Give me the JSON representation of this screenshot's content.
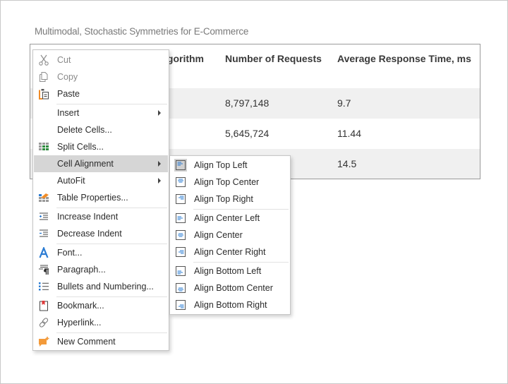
{
  "document": {
    "title": "Multimodal, Stochastic Symmetries for E-Commerce"
  },
  "table": {
    "headers": [
      "Algorithm",
      "Number of Requests",
      "Average Response Time, ms"
    ],
    "header_visible_fragment": "lgorithm",
    "rows": [
      {
        "requests": "8,797,148",
        "response_time": "9.7"
      },
      {
        "requests": "5,645,724",
        "response_time": "11.44"
      },
      {
        "requests": "",
        "response_time": "14.5"
      }
    ]
  },
  "context_menu": {
    "items": [
      {
        "label": "Cut",
        "icon": "scissors-icon",
        "disabled": true
      },
      {
        "label": "Copy",
        "icon": "copy-icon",
        "disabled": true
      },
      {
        "label": "Paste",
        "icon": "clipboard-paste-icon"
      },
      {
        "label": "Insert",
        "submenu": true
      },
      {
        "label": "Delete Cells..."
      },
      {
        "label": "Split Cells...",
        "icon": "split-cells-icon"
      },
      {
        "label": "Cell Alignment",
        "submenu": true,
        "active": true
      },
      {
        "label": "AutoFit",
        "submenu": true
      },
      {
        "label": "Table Properties...",
        "icon": "table-properties-icon"
      },
      {
        "label": "Increase Indent",
        "icon": "increase-indent-icon"
      },
      {
        "label": "Decrease Indent",
        "icon": "decrease-indent-icon"
      },
      {
        "label": "Font...",
        "icon": "font-icon"
      },
      {
        "label": "Paragraph...",
        "icon": "paragraph-icon"
      },
      {
        "label": "Bullets and Numbering...",
        "icon": "bullets-icon"
      },
      {
        "label": "Bookmark...",
        "icon": "bookmark-icon"
      },
      {
        "label": "Hyperlink...",
        "icon": "hyperlink-icon"
      },
      {
        "label": "New Comment",
        "icon": "new-comment-icon"
      }
    ]
  },
  "alignment_submenu": {
    "items": [
      {
        "label": "Align Top Left",
        "selected": true
      },
      {
        "label": "Align Top Center"
      },
      {
        "label": "Align Top Right"
      },
      {
        "label": "Align Center Left"
      },
      {
        "label": "Align Center"
      },
      {
        "label": "Align Center Right"
      },
      {
        "label": "Align Bottom Left"
      },
      {
        "label": "Align Bottom Center"
      },
      {
        "label": "Align Bottom Right"
      }
    ]
  },
  "colors": {
    "accent_blue": "#2b7cd3",
    "paste_orange": "#f08c28",
    "split_green": "#2e8b3e",
    "bookmark_red": "#e03a3a",
    "comment_orange": "#f39a3a",
    "menu_highlight": "#d6d6d6",
    "row_shade": "#f0f0f0"
  }
}
